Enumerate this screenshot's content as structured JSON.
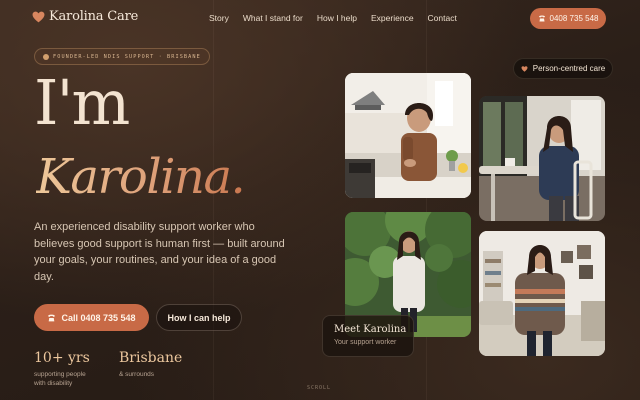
{
  "brand": {
    "name": "Karolina Care",
    "accent": "#c86a46"
  },
  "nav": {
    "links": [
      "Story",
      "What I stand for",
      "How I help",
      "Experience",
      "Contact"
    ],
    "cta_label": "0408 735 548"
  },
  "hero": {
    "eyebrow": "FOUNDER-LED NDIS SUPPORT · BRISBANE",
    "heading_line1": "I'm",
    "heading_line2": "Karolina.",
    "lede": "An experienced disability support worker who believes good support is human first — built around your goals, your routines, and your idea of a good day.",
    "primary_button": "Call 0408 735 548",
    "secondary_button": "How I can help",
    "stats": [
      {
        "value": "10+ yrs",
        "label_line1": "supporting people",
        "label_line2": "with disability"
      },
      {
        "value": "Brisbane",
        "label_line1": "& surrounds",
        "label_line2": ""
      }
    ],
    "scroll_hint": "SCROLL"
  },
  "gallery": {
    "badge": "Person-centred care",
    "card_title": "Meet Karolina",
    "card_subtitle": "Your support worker",
    "icons": [
      "heart-icon",
      "phone-icon",
      "sparkle-icon"
    ]
  }
}
